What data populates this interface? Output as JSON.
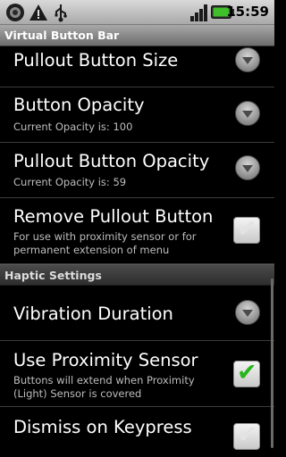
{
  "status_bar": {
    "time": "15:59",
    "icons": [
      "notification-icon",
      "warning-icon",
      "usb-icon",
      "signal-icon",
      "battery-icon"
    ]
  },
  "title_bar": {
    "title": "Virtual Button Bar"
  },
  "items": [
    {
      "title": "Pullout Button Size",
      "summary": "",
      "widget": "dropdown"
    },
    {
      "title": "Button Opacity",
      "summary": "Current Opacity is: 100",
      "widget": "dropdown"
    },
    {
      "title": "Pullout Button Opacity",
      "summary": "Current Opacity is: 59",
      "widget": "dropdown"
    },
    {
      "title": "Remove Pullout Button",
      "summary": "For use with proximity sensor or for permanent extension of menu",
      "widget": "checkbox",
      "checked": false
    }
  ],
  "section": {
    "label": "Haptic Settings"
  },
  "haptic_items": [
    {
      "title": "Vibration Duration",
      "summary": "",
      "widget": "dropdown"
    },
    {
      "title": "Use Proximity Sensor",
      "summary": "Buttons will extend when Proximity (Light) Sensor is covered",
      "widget": "checkbox",
      "checked": true
    },
    {
      "title": "Dismiss on Keypress",
      "summary": "",
      "widget": "checkbox",
      "checked": false
    }
  ],
  "colors": {
    "check_green": "#27b51d",
    "summary_text": "#bdbdbd",
    "status_bar": "#c4c4c4"
  }
}
